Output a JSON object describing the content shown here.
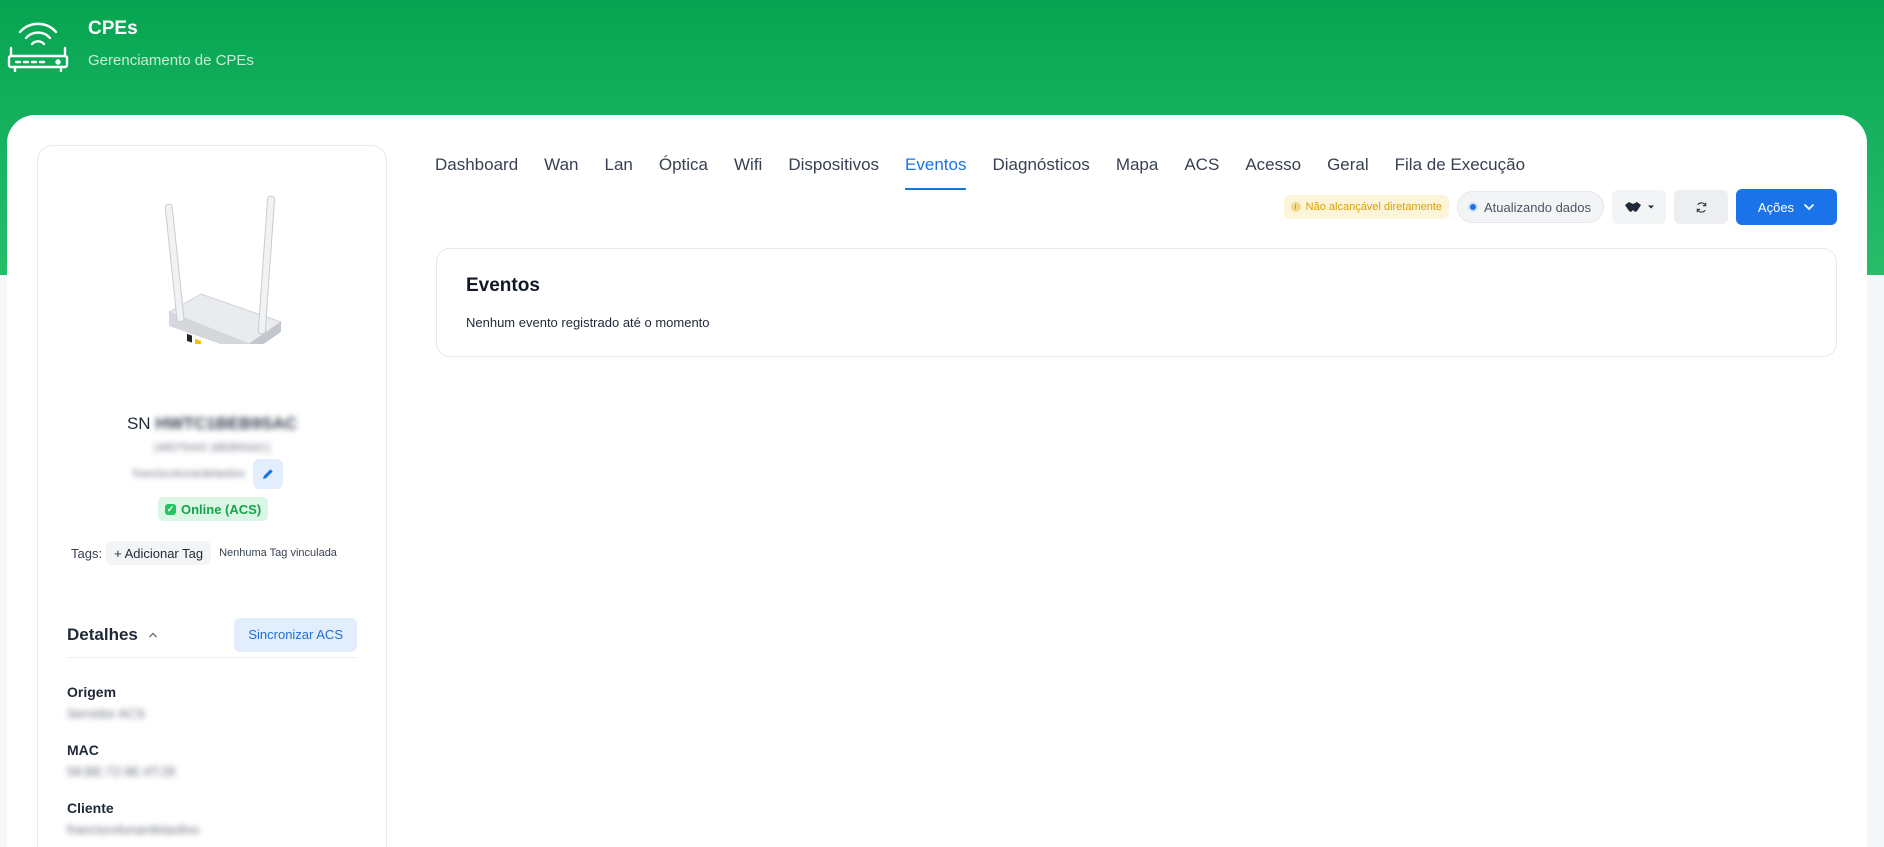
{
  "header": {
    "title": "CPEs",
    "subtitle": "Gerenciamento de CPEs"
  },
  "device": {
    "sn_prefix": "SN",
    "sn_value": "HWTC1BEB9SAC",
    "sub_id": "(48575443 1BEB9SAC)",
    "client_short": "franciscolunardelaolivo",
    "status": "Online (ACS)"
  },
  "tags": {
    "label": "Tags:",
    "add_label": "+ Adicionar Tag",
    "empty": "Nenhuma Tag vinculada"
  },
  "details": {
    "title": "Detalhes",
    "sync_label": "Sincronizar ACS",
    "fields": [
      {
        "label": "Origem",
        "value": "Servidor ACS"
      },
      {
        "label": "MAC",
        "value": "58:BE:72:9E:4T:28"
      },
      {
        "label": "Cliente",
        "value": "franciscolunardelaolivo"
      }
    ]
  },
  "tabs": [
    {
      "label": "Dashboard"
    },
    {
      "label": "Wan"
    },
    {
      "label": "Lan"
    },
    {
      "label": "Óptica"
    },
    {
      "label": "Wifi"
    },
    {
      "label": "Dispositivos"
    },
    {
      "label": "Eventos"
    },
    {
      "label": "Diagnósticos"
    },
    {
      "label": "Mapa"
    },
    {
      "label": "ACS"
    },
    {
      "label": "Acesso"
    },
    {
      "label": "Geral"
    },
    {
      "label": "Fila de Execução"
    }
  ],
  "active_tab": "Eventos",
  "toolbar": {
    "warning": "Não alcançável diretamente",
    "updating": "Atualizando dados",
    "actions_label": "Ações"
  },
  "events": {
    "title": "Eventos",
    "empty": "Nenhum evento registrado até o momento"
  },
  "colors": {
    "brand_green": "#06a451",
    "accent_blue": "#1a73e8",
    "online_green": "#16a34a",
    "warn_yellow": "#d9a100"
  },
  "icons": [
    "router-wifi-icon",
    "pencil-icon",
    "check-icon",
    "chevron-up-icon",
    "info-icon",
    "handshake-icon",
    "caret-down-icon",
    "refresh-icon",
    "chevron-down-icon"
  ]
}
